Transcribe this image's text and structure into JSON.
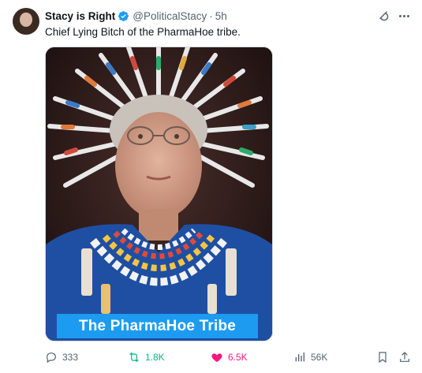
{
  "author": {
    "display_name": "Stacy is Right",
    "handle": "@PoliticalStacy",
    "separator": "·",
    "time": "5h"
  },
  "tweet": {
    "text": "Chief Lying Bitch of the PharmaHoe tribe."
  },
  "media": {
    "caption": "The PharmaHoe Tribe"
  },
  "actions": {
    "replies": "333",
    "reposts": "1.8K",
    "likes": "6.5K",
    "views": "56K"
  },
  "icons": [
    "verified-icon",
    "grok-icon",
    "more-icon",
    "reply-icon",
    "repost-icon",
    "like-icon",
    "views-icon",
    "bookmark-icon",
    "share-icon"
  ],
  "colors": {
    "accent": "#1d9bf0",
    "repost_active": "#00ba7c",
    "like_active": "#f91880",
    "muted": "#536471"
  }
}
